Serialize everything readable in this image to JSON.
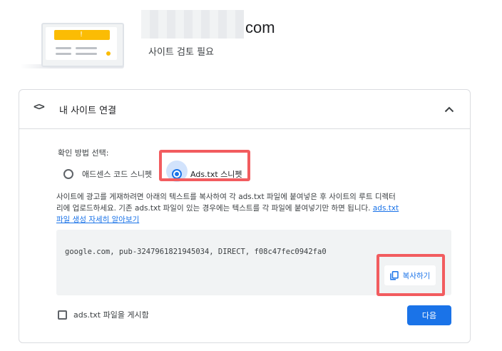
{
  "header": {
    "domain_suffix": "com",
    "review_status": "사이트 검토 필요"
  },
  "card": {
    "title": "내 사이트 연결",
    "header_icon": "code-icon",
    "collapse_icon": "chevron-up-icon",
    "method_label": "확인 방법 선택:",
    "options": [
      {
        "label": "애드센스 코드 스니펫",
        "selected": false
      },
      {
        "label": "Ads.txt 스니펫",
        "selected": true
      }
    ],
    "description_line1": "사이트에 광고를 게재하려면 아래의 텍스트를 복사하여 각 ads.txt 파일에 붙여넣은 후 사이트의 루트 디렉터",
    "description_line2": "리에 업로드하세요. 기존 ads.txt 파일이 있는 경우에는 텍스트를 각 파일에 붙여넣기만 하면 됩니다.",
    "description_link": "ads.txt",
    "learn_more": "파일 생성 자세히 알아보기",
    "code_snippet": "google.com, pub-3247961821945034, DIRECT, f08c47fec0942fa0",
    "copy_label": "복사하기",
    "copy_icon": "copy-icon",
    "publish_checkbox_label": "ads.txt 파일을 게시함",
    "publish_checked": false,
    "next_label": "다음"
  },
  "colors": {
    "accent": "#1a73e8",
    "highlight": "#f25c5f",
    "warning": "#fbbc04"
  }
}
